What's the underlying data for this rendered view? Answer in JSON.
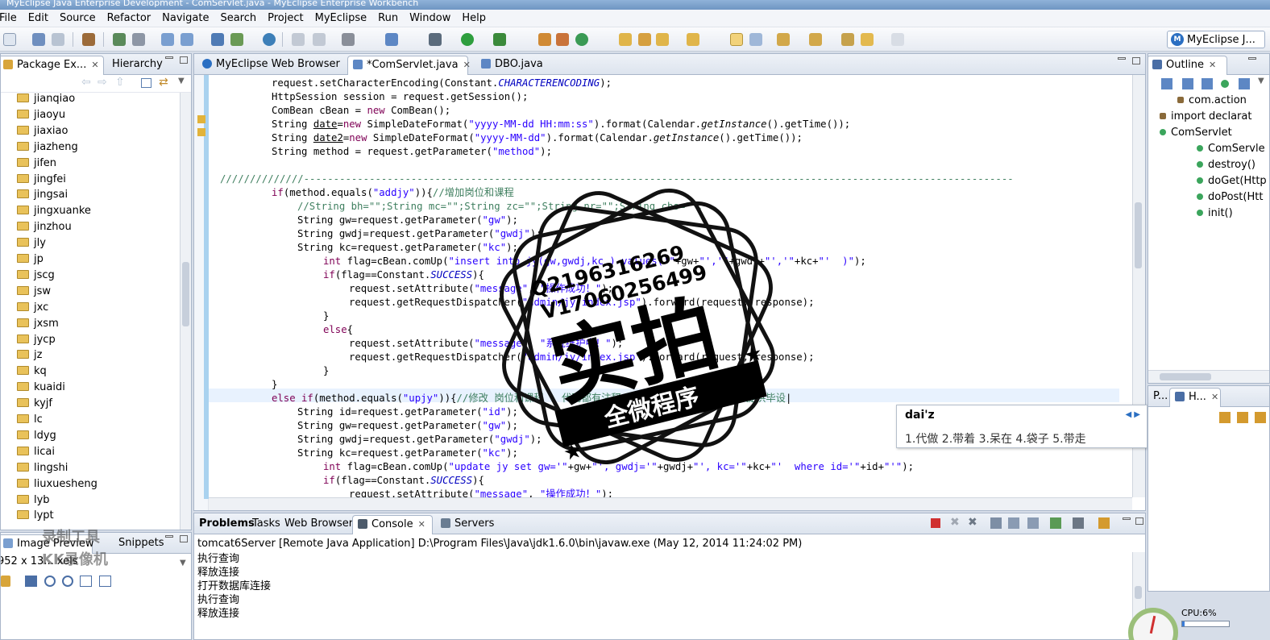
{
  "window": {
    "title": "MyEclipse Java Enterprise Development - ComServlet.java - MyEclipse Enterprise Workbench"
  },
  "menu": [
    "File",
    "Edit",
    "Source",
    "Refactor",
    "Navigate",
    "Search",
    "Project",
    "MyEclipse",
    "Run",
    "Window",
    "Help"
  ],
  "perspective": {
    "label": "MyEclipse J...",
    "logo": "M"
  },
  "left_panel": {
    "tabs": [
      "Package Ex...",
      "Hierarchy"
    ],
    "tree": [
      "jianqiao",
      "jiaoyu",
      "jiaxiao",
      "jiazheng",
      "jifen",
      "jingfei",
      "jingsai",
      "jingxuanke",
      "jinzhou",
      "jly",
      "jp",
      "jscg",
      "jsw",
      "jxc",
      "jxsm",
      "jycp",
      "jz",
      "kq",
      "kuaidi",
      "kyjf",
      "lc",
      "ldyg",
      "licai",
      "lingshi",
      "liuxuesheng",
      "lyb",
      "lypt"
    ]
  },
  "bottom_left": {
    "tabs": [
      "Image Preview",
      "Snippets"
    ],
    "info": "952 x 13... xels"
  },
  "editor": {
    "tabs": [
      "MyEclipse Web Browser",
      "*ComServlet.java",
      "DBO.java"
    ]
  },
  "outline": {
    "tab": "Outline",
    "items": [
      "com.action",
      "import declarat",
      "ComServlet",
      "ComServle",
      "destroy()",
      "doGet(Http",
      "doPost(Htt",
      "init()"
    ]
  },
  "right_bottom": {
    "tabs": [
      "P...",
      "H..."
    ]
  },
  "ime": {
    "composition": "dai'z",
    "candidates": "1.代做  2.带着  3.呆在  4.袋子  5.带走"
  },
  "sticker": {
    "line1": "Q2196316269",
    "line2": "V17060256499",
    "big": "实拍",
    "banner": "全微程序"
  },
  "console": {
    "tabs": [
      "Problems",
      "Tasks",
      "Web Browser",
      "Console",
      "Servers"
    ],
    "header": "tomcat6Server [Remote Java Application] D:\\Program Files\\Java\\jdk1.6.0\\bin\\javaw.exe (May 12, 2014 11:24:02 PM)",
    "lines": [
      "执行查询",
      "释放连接",
      "打开数据库连接",
      "执行查询",
      "释放连接"
    ]
  },
  "watermark": {
    "line1": "录制工具",
    "line2": "KK录像机"
  },
  "cpu": {
    "label": "CPU:6%",
    "value": 6
  }
}
